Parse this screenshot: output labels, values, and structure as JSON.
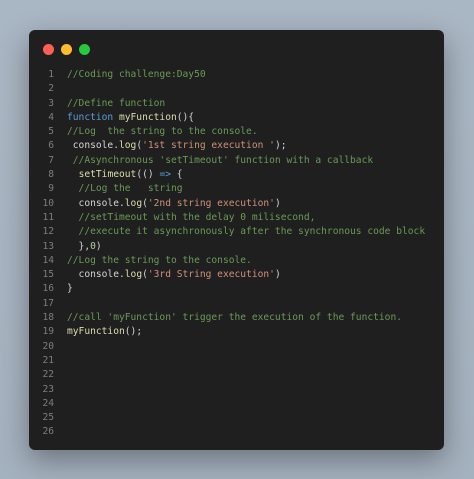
{
  "window": {
    "controls": [
      {
        "name": "close",
        "color": "#ff5f56"
      },
      {
        "name": "minimize",
        "color": "#ffbd2e"
      },
      {
        "name": "maximize",
        "color": "#27c93f"
      }
    ]
  },
  "theme": {
    "comment": "#6a9955",
    "keyword": "#569cd6",
    "function": "#dcdcaa",
    "string": "#ce9178",
    "number": "#b5cea8",
    "plain": "#d4d4d4",
    "line_number": "#7d7d7d",
    "background": "#1f1f1f"
  },
  "code": {
    "lines": [
      {
        "num": "1",
        "tokens": [
          {
            "t": "comment",
            "v": "//Coding challenge:Day50"
          }
        ]
      },
      {
        "num": "2",
        "tokens": []
      },
      {
        "num": "3",
        "tokens": [
          {
            "t": "comment",
            "v": "//Define function"
          }
        ]
      },
      {
        "num": "4",
        "tokens": [
          {
            "t": "keyword",
            "v": "function "
          },
          {
            "t": "function",
            "v": "myFunction"
          },
          {
            "t": "plain",
            "v": "(){"
          }
        ]
      },
      {
        "num": "5",
        "tokens": [
          {
            "t": "comment",
            "v": "//Log  the string to the console."
          }
        ]
      },
      {
        "num": "6",
        "tokens": [
          {
            "t": "plain",
            "v": " console."
          },
          {
            "t": "function",
            "v": "log"
          },
          {
            "t": "plain",
            "v": "("
          },
          {
            "t": "string",
            "v": "'1st string execution '"
          },
          {
            "t": "plain",
            "v": ");"
          }
        ]
      },
      {
        "num": "7",
        "tokens": [
          {
            "t": "comment",
            "v": " //Asynchronous 'setTimeout' function with a callback"
          }
        ]
      },
      {
        "num": "8",
        "tokens": [
          {
            "t": "plain",
            "v": "  "
          },
          {
            "t": "function",
            "v": "setTimeout"
          },
          {
            "t": "plain",
            "v": "(() "
          },
          {
            "t": "keyword",
            "v": "=>"
          },
          {
            "t": "plain",
            "v": " {"
          }
        ]
      },
      {
        "num": "9",
        "tokens": [
          {
            "t": "comment",
            "v": "  //Log the   string"
          }
        ]
      },
      {
        "num": "10",
        "tokens": [
          {
            "t": "plain",
            "v": "  console."
          },
          {
            "t": "function",
            "v": "log"
          },
          {
            "t": "plain",
            "v": "("
          },
          {
            "t": "string",
            "v": "'2nd string execution'"
          },
          {
            "t": "plain",
            "v": ")"
          }
        ]
      },
      {
        "num": "11",
        "tokens": [
          {
            "t": "comment",
            "v": "  //setTimeout with the delay 0 milisecond,"
          }
        ]
      },
      {
        "num": "12",
        "tokens": [
          {
            "t": "comment",
            "v": "  //execute it asynchronously after the synchronous code block"
          }
        ]
      },
      {
        "num": "13",
        "tokens": [
          {
            "t": "plain",
            "v": "  },"
          },
          {
            "t": "number",
            "v": "0"
          },
          {
            "t": "plain",
            "v": ")"
          }
        ]
      },
      {
        "num": "14",
        "tokens": [
          {
            "t": "comment",
            "v": "//Log the string to the console."
          }
        ]
      },
      {
        "num": "15",
        "tokens": [
          {
            "t": "plain",
            "v": "  console."
          },
          {
            "t": "function",
            "v": "log"
          },
          {
            "t": "plain",
            "v": "("
          },
          {
            "t": "string",
            "v": "'3rd String execution'"
          },
          {
            "t": "plain",
            "v": ")"
          }
        ]
      },
      {
        "num": "16",
        "tokens": [
          {
            "t": "plain",
            "v": "}"
          }
        ]
      },
      {
        "num": "17",
        "tokens": []
      },
      {
        "num": "18",
        "tokens": [
          {
            "t": "comment",
            "v": "//call 'myFunction' trigger the execution of the function."
          }
        ]
      },
      {
        "num": "19",
        "tokens": [
          {
            "t": "function",
            "v": "myFunction"
          },
          {
            "t": "plain",
            "v": "();"
          }
        ]
      },
      {
        "num": "20",
        "tokens": []
      },
      {
        "num": "21",
        "tokens": []
      },
      {
        "num": "22",
        "tokens": []
      },
      {
        "num": "23",
        "tokens": []
      },
      {
        "num": "24",
        "tokens": []
      },
      {
        "num": "25",
        "tokens": []
      },
      {
        "num": "26",
        "tokens": []
      }
    ]
  }
}
